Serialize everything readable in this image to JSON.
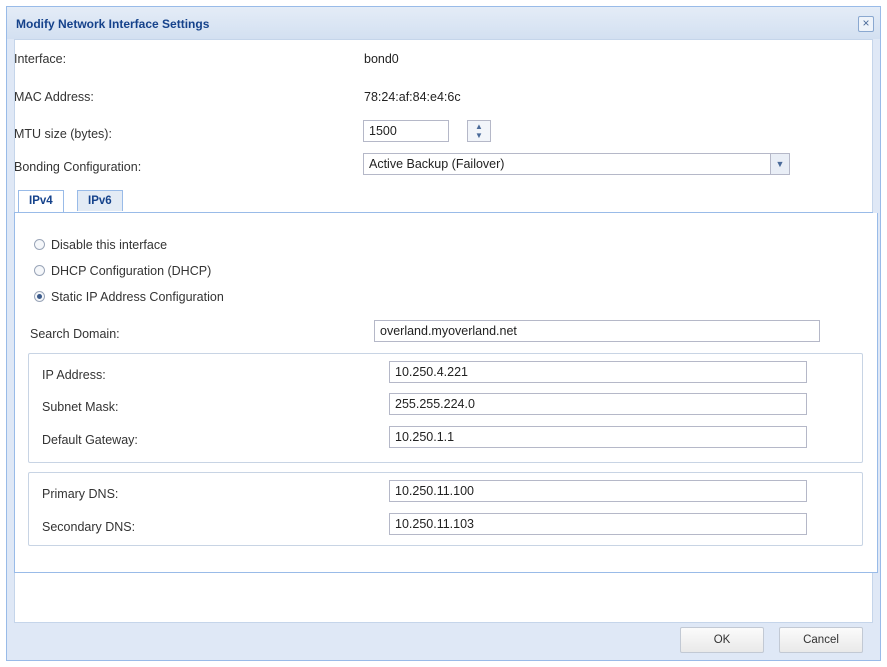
{
  "dialog": {
    "title": "Modify Network Interface Settings",
    "close_glyph": "×"
  },
  "interface": {
    "label": "Interface:",
    "value": "bond0"
  },
  "mac": {
    "label": "MAC Address:",
    "value": "78:24:af:84:e4:6c"
  },
  "mtu": {
    "label": "MTU size (bytes):",
    "value": "1500"
  },
  "bonding": {
    "label": "Bonding Configuration:",
    "value": "Active Backup (Failover)"
  },
  "tabs": [
    {
      "label": "IPv4",
      "active": true
    },
    {
      "label": "IPv6",
      "active": false
    }
  ],
  "ipv4": {
    "options": [
      {
        "label": "Disable this interface",
        "checked": false
      },
      {
        "label": "DHCP Configuration (DHCP)",
        "checked": false
      },
      {
        "label": "Static IP Address Configuration",
        "checked": true
      }
    ],
    "search_domain": {
      "label": "Search Domain:",
      "value": "overland.myoverland.net"
    },
    "ip_address": {
      "label": "IP Address:",
      "value": "10.250.4.221"
    },
    "subnet_mask": {
      "label": "Subnet Mask:",
      "value": "255.255.224.0"
    },
    "gateway": {
      "label": "Default Gateway:",
      "value": "10.250.1.1"
    },
    "primary_dns": {
      "label": "Primary DNS:",
      "value": "10.250.11.100"
    },
    "secondary_dns": {
      "label": "Secondary DNS:",
      "value": "10.250.11.103"
    }
  },
  "buttons": {
    "ok": "OK",
    "cancel": "Cancel"
  },
  "icons": {
    "spinner_up": "▲",
    "spinner_down": "▼",
    "dropdown": "▼"
  },
  "colors": {
    "title": "#15428b",
    "frame": "#99bbe8",
    "dialog_bg": "#dfe8f6"
  }
}
